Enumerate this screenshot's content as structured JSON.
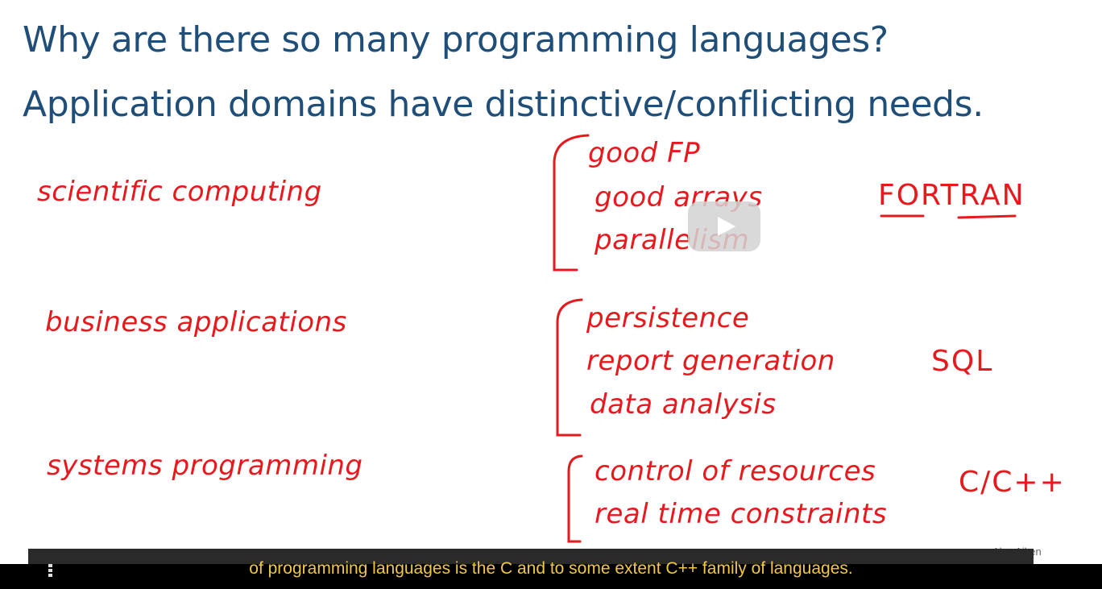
{
  "slide": {
    "title_line1": "Why are there so many programming languages?",
    "title_line2": "Application domains have distinctive/conflicting needs.",
    "domains": [
      {
        "name": "scientific computing",
        "needs": [
          "good FP",
          "good arrays",
          "parallelism"
        ],
        "language": "FORTRAN"
      },
      {
        "name": "business applications",
        "needs": [
          "persistence",
          "report generation",
          "data analysis"
        ],
        "language": "SQL"
      },
      {
        "name": "systems programming",
        "needs": [
          "control of resources",
          "real time constraints"
        ],
        "language": "C/C++"
      }
    ],
    "author": "Alex Aiken"
  },
  "player": {
    "caption": "of programming languages is the C and to some extent C++ family of languages.",
    "play_icon": "play-icon",
    "menu_icon": "menu-dots-icon"
  },
  "colors": {
    "title": "#1f4e79",
    "ink": "#e8191d",
    "caption_text": "#f2c744"
  }
}
